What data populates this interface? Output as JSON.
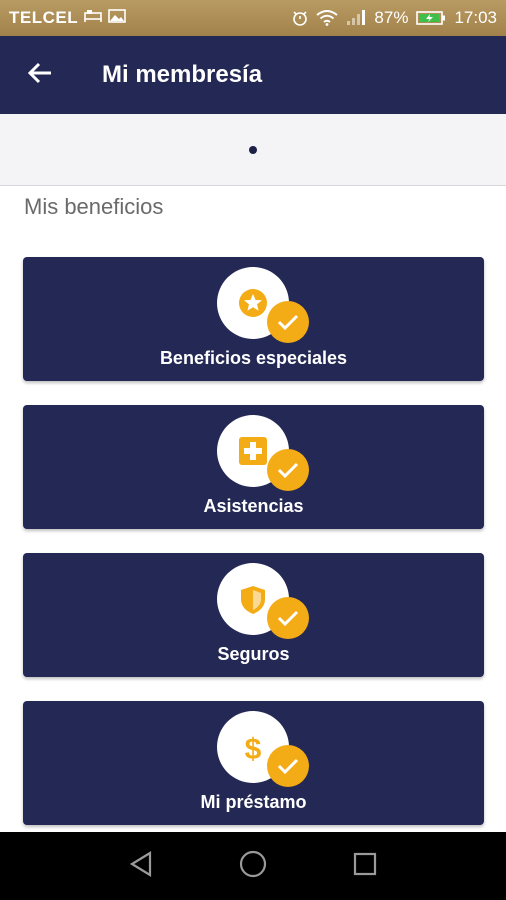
{
  "status_bar": {
    "carrier": "TELCEL",
    "battery": "87%",
    "time": "17:03"
  },
  "app_bar": {
    "title": "Mi membresía",
    "back_icon": "arrow-left-icon"
  },
  "pager": {
    "pages": 1,
    "current": 1
  },
  "section_title": "Mis beneficios",
  "cards": [
    {
      "label": "Beneficios especiales",
      "icon": "star-badge-icon"
    },
    {
      "label": "Asistencias",
      "icon": "medical-cross-icon"
    },
    {
      "label": "Seguros",
      "icon": "shield-icon"
    },
    {
      "label": "Mi préstamo",
      "icon": "dollar-icon"
    }
  ],
  "colors": {
    "primary": "#242855",
    "accent": "#f3ab16",
    "status_bar": "#a98a55",
    "section_text": "#6a6a6a"
  }
}
